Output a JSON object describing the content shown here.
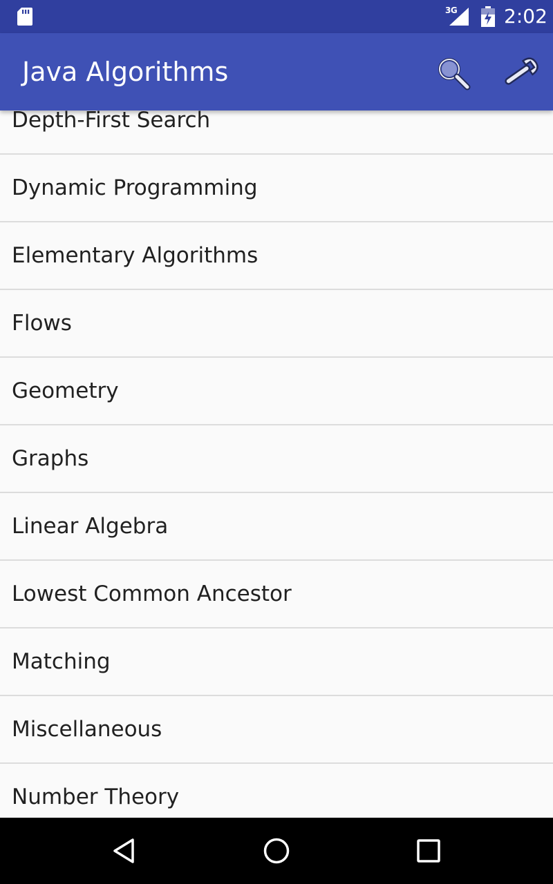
{
  "status_bar": {
    "time": "2:02",
    "network_type": "3G",
    "icons": [
      "sd-card-icon",
      "signal-icon",
      "battery-icon"
    ]
  },
  "app_bar": {
    "title": "Java Algorithms",
    "actions": [
      {
        "name": "search",
        "icon": "search-icon"
      },
      {
        "name": "settings",
        "icon": "wrench-icon"
      }
    ]
  },
  "list": {
    "items": [
      "Depth-First Search",
      "Dynamic Programming",
      "Elementary Algorithms",
      "Flows",
      "Geometry",
      "Graphs",
      "Linear Algebra",
      "Lowest Common Ancestor",
      "Matching",
      "Miscellaneous",
      "Number Theory"
    ]
  },
  "nav_bar": {
    "buttons": [
      "back-icon",
      "home-icon",
      "recents-icon"
    ]
  },
  "colors": {
    "status_bar": "#303f9f",
    "app_bar": "#3f51b5",
    "background": "#fafafa",
    "divider": "#dcdcdc",
    "text": "#212121",
    "nav_bar": "#000000"
  }
}
